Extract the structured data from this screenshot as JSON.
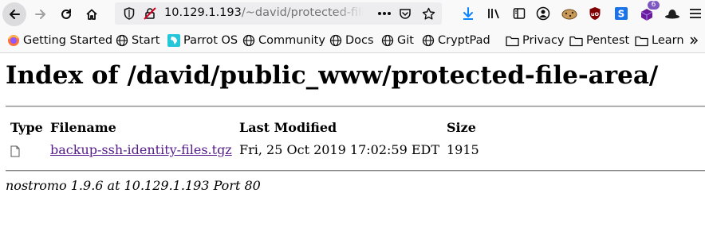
{
  "browser": {
    "url_host": "10.129.1.193",
    "url_path": "/~david/protected-file-area/"
  },
  "bookmarks": [
    {
      "label": "Getting Started",
      "icon": "firefox-icon"
    },
    {
      "label": "Start",
      "icon": "globe-icon"
    },
    {
      "label": "Parrot OS",
      "icon": "parrot-icon"
    },
    {
      "label": "Community",
      "icon": "globe-icon"
    },
    {
      "label": "Docs",
      "icon": "globe-icon"
    },
    {
      "label": "Git",
      "icon": "globe-icon"
    },
    {
      "label": "CryptPad",
      "icon": "globe-icon"
    },
    {
      "label": "Privacy",
      "icon": "folder-icon"
    },
    {
      "label": "Pentest",
      "icon": "folder-icon"
    },
    {
      "label": "Learn",
      "icon": "folder-icon"
    }
  ],
  "extensions": {
    "notification_count": "6"
  },
  "page": {
    "heading": "Index of /david/public_www/protected-file-area/",
    "columns": {
      "type": "Type",
      "filename": "Filename",
      "modified": "Last Modified",
      "size": "Size"
    },
    "files": [
      {
        "type_icon": "file-icon",
        "name": "backup-ssh-identity-files.tgz",
        "modified": "Fri, 25 Oct 2019 17:02:59 EDT",
        "size": "1915"
      }
    ],
    "footer": "nostromo 1.9.6 at 10.129.1.193 Port 80"
  },
  "colors": {
    "link_visited": "#551a8b",
    "toolbar_bg": "#f9f9fa"
  }
}
